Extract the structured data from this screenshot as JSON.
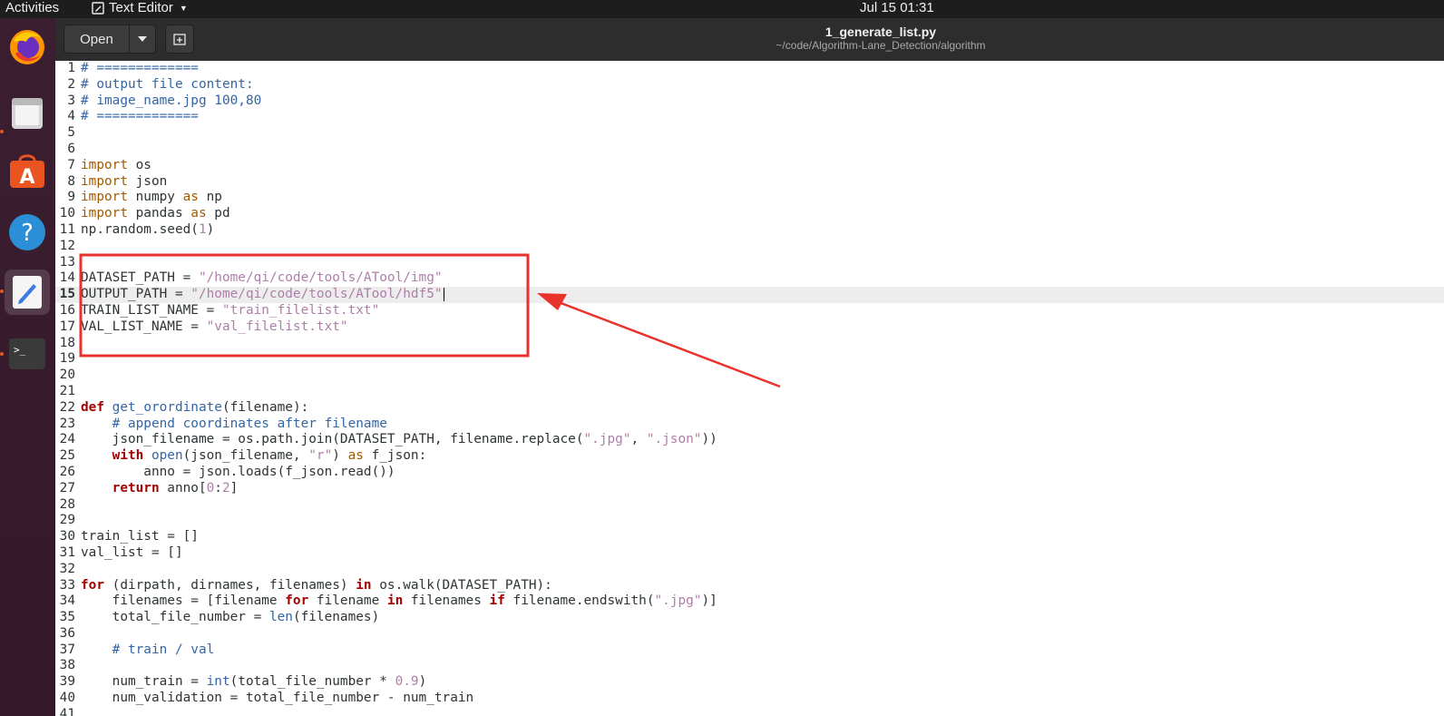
{
  "topbar": {
    "activities": "Activities",
    "app_name": "Text Editor",
    "clock": "Jul 15  01:31"
  },
  "dock": {
    "items": [
      {
        "name": "firefox-icon"
      },
      {
        "name": "files-icon"
      },
      {
        "name": "software-icon"
      },
      {
        "name": "help-icon"
      },
      {
        "name": "text-editor-icon"
      },
      {
        "name": "terminal-icon"
      }
    ]
  },
  "header": {
    "open_label": "Open",
    "title": "1_generate_list.py",
    "subtitle": "~/code/Algorithm-Lane_Detection/algorithm"
  },
  "colors": {
    "highlight_box": "#e8322b",
    "arrow": "#e8322b"
  },
  "editor": {
    "current_line": 15,
    "lines": [
      {
        "n": "1",
        "t": [
          [
            "cmt",
            "# ============="
          ]
        ]
      },
      {
        "n": "2",
        "t": [
          [
            "cmt",
            "# output file content:"
          ]
        ]
      },
      {
        "n": "3",
        "t": [
          [
            "cmt",
            "# image_name.jpg 100,80"
          ]
        ]
      },
      {
        "n": "4",
        "t": [
          [
            "cmt",
            "# ============="
          ]
        ]
      },
      {
        "n": "5",
        "t": []
      },
      {
        "n": "6",
        "t": []
      },
      {
        "n": "7",
        "t": [
          [
            "kw",
            "import"
          ],
          [
            "",
            " os"
          ]
        ]
      },
      {
        "n": "8",
        "t": [
          [
            "kw",
            "import"
          ],
          [
            "",
            " json"
          ]
        ]
      },
      {
        "n": "9",
        "t": [
          [
            "kw",
            "import"
          ],
          [
            "",
            " numpy "
          ],
          [
            "kw",
            "as"
          ],
          [
            "",
            " np"
          ]
        ]
      },
      {
        "n": "10",
        "t": [
          [
            "kw",
            "import"
          ],
          [
            "",
            " pandas "
          ],
          [
            "kw",
            "as"
          ],
          [
            "",
            " pd"
          ]
        ]
      },
      {
        "n": "11",
        "t": [
          [
            "",
            "np.random.seed("
          ],
          [
            "num",
            "1"
          ],
          [
            "",
            ")"
          ]
        ]
      },
      {
        "n": "12",
        "t": []
      },
      {
        "n": "13",
        "t": []
      },
      {
        "n": "14",
        "t": [
          [
            "",
            "DATASET_PATH = "
          ],
          [
            "str",
            "\"/home/qi/code/tools/ATool/img\""
          ]
        ]
      },
      {
        "n": "15",
        "t": [
          [
            "",
            "OUTPUT_PATH = "
          ],
          [
            "str",
            "\"/home/qi/code/tools/ATool/hdf5\""
          ]
        ]
      },
      {
        "n": "16",
        "t": [
          [
            "",
            "TRAIN_LIST_NAME = "
          ],
          [
            "str",
            "\"train_filelist.txt\""
          ]
        ]
      },
      {
        "n": "17",
        "t": [
          [
            "",
            "VAL_LIST_NAME = "
          ],
          [
            "str",
            "\"val_filelist.txt\""
          ]
        ]
      },
      {
        "n": "18",
        "t": []
      },
      {
        "n": "19",
        "t": []
      },
      {
        "n": "20",
        "t": []
      },
      {
        "n": "21",
        "t": []
      },
      {
        "n": "22",
        "t": [
          [
            "kwb",
            "def"
          ],
          [
            "",
            " "
          ],
          [
            "fn",
            "get_orordinate"
          ],
          [
            "",
            "(filename):"
          ]
        ]
      },
      {
        "n": "23",
        "t": [
          [
            "",
            "    "
          ],
          [
            "cmt",
            "# append coordinates after filename"
          ]
        ]
      },
      {
        "n": "24",
        "t": [
          [
            "",
            "    json_filename = os.path.join(DATASET_PATH, filename.replace("
          ],
          [
            "str",
            "\".jpg\""
          ],
          [
            "",
            ", "
          ],
          [
            "str",
            "\".json\""
          ],
          [
            "",
            "))"
          ]
        ]
      },
      {
        "n": "25",
        "t": [
          [
            "",
            "    "
          ],
          [
            "kwb",
            "with"
          ],
          [
            "",
            " "
          ],
          [
            "bi",
            "open"
          ],
          [
            "",
            "(json_filename, "
          ],
          [
            "str",
            "\"r\""
          ],
          [
            "",
            ") "
          ],
          [
            "kw",
            "as"
          ],
          [
            "",
            " f_json:"
          ]
        ]
      },
      {
        "n": "26",
        "t": [
          [
            "",
            "        anno = json.loads(f_json.read())"
          ]
        ]
      },
      {
        "n": "27",
        "t": [
          [
            "",
            "    "
          ],
          [
            "kwb",
            "return"
          ],
          [
            "",
            " anno["
          ],
          [
            "num",
            "0"
          ],
          [
            "",
            ":"
          ],
          [
            "num",
            "2"
          ],
          [
            "",
            "]"
          ]
        ]
      },
      {
        "n": "28",
        "t": []
      },
      {
        "n": "29",
        "t": []
      },
      {
        "n": "30",
        "t": [
          [
            "",
            "train_list = []"
          ]
        ]
      },
      {
        "n": "31",
        "t": [
          [
            "",
            "val_list = []"
          ]
        ]
      },
      {
        "n": "32",
        "t": []
      },
      {
        "n": "33",
        "t": [
          [
            "kwb",
            "for"
          ],
          [
            "",
            " (dirpath, dirnames, filenames) "
          ],
          [
            "kwb",
            "in"
          ],
          [
            "",
            " os.walk(DATASET_PATH):"
          ]
        ]
      },
      {
        "n": "34",
        "t": [
          [
            "",
            "    filenames = [filename "
          ],
          [
            "kwb",
            "for"
          ],
          [
            "",
            " filename "
          ],
          [
            "kwb",
            "in"
          ],
          [
            "",
            " filenames "
          ],
          [
            "kwb",
            "if"
          ],
          [
            "",
            " filename.endswith("
          ],
          [
            "str",
            "\".jpg\""
          ],
          [
            "",
            ")]"
          ]
        ]
      },
      {
        "n": "35",
        "t": [
          [
            "",
            "    total_file_number = "
          ],
          [
            "bi",
            "len"
          ],
          [
            "",
            "(filenames)"
          ]
        ]
      },
      {
        "n": "36",
        "t": []
      },
      {
        "n": "37",
        "t": [
          [
            "",
            "    "
          ],
          [
            "cmt",
            "# train / val"
          ]
        ]
      },
      {
        "n": "38",
        "t": []
      },
      {
        "n": "39",
        "t": [
          [
            "",
            "    num_train = "
          ],
          [
            "bi",
            "int"
          ],
          [
            "",
            "(total_file_number * "
          ],
          [
            "num",
            "0.9"
          ],
          [
            "",
            ")"
          ]
        ]
      },
      {
        "n": "40",
        "t": [
          [
            "",
            "    num_validation = total_file_number - num_train"
          ]
        ]
      },
      {
        "n": "41",
        "t": []
      }
    ]
  }
}
